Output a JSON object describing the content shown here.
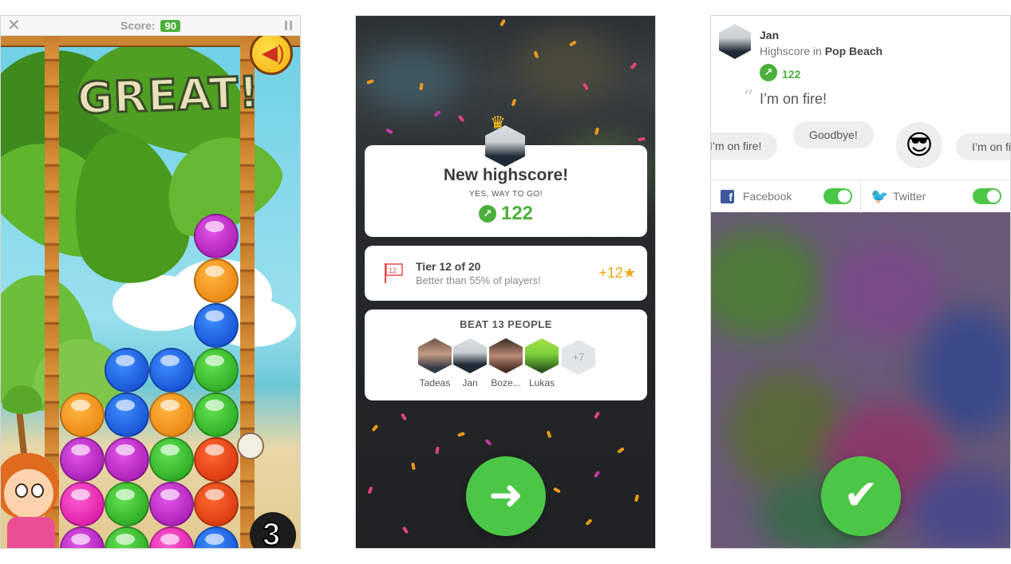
{
  "game": {
    "close_icon": "close-icon",
    "score_label": "Score:",
    "score_value": "90",
    "pause_icon": "pause-icon",
    "banner": "GREAT!",
    "sound_icon": "speaker-icon",
    "bomb_count": "3",
    "ball_colors": {
      "purple": "#c22ccc",
      "orange": "#f59a12",
      "blue": "#1563ef",
      "green": "#34c22a",
      "red": "#ea4a12",
      "pink": "#f033bb"
    }
  },
  "highscore": {
    "title": "New highscore!",
    "subtitle": "YES, WAY TO GO!",
    "score": "122",
    "tier": {
      "title": "Tier 12 of 20",
      "subtitle": "Better than 55% of players!",
      "flag_number": "12",
      "reward": "+12"
    },
    "beat": {
      "title": "BEAT 13 PEOPLE",
      "people": [
        {
          "name": "Tadeas"
        },
        {
          "name": "Jan"
        },
        {
          "name": "Boze..."
        },
        {
          "name": "Lukas"
        }
      ],
      "more": "+7"
    },
    "next_icon": "arrow-right-icon"
  },
  "share": {
    "user_name": "Jan",
    "highscore_prefix": "Highscore in",
    "game_name": "Pop Beach",
    "score": "122",
    "quote": "I’m on fire!",
    "chips": {
      "left": "I’m on fire!",
      "goodbye": "Goodbye!",
      "emoji": "😎",
      "right": "I’m on fire!"
    },
    "facebook_label": "Facebook",
    "twitter_label": "Twitter",
    "confirm_icon": "checkmark-icon"
  },
  "colors": {
    "accent_green": "#4caf3c",
    "button_green": "#4cc646",
    "reward_orange": "#f5a417",
    "facebook_blue": "#3b5998",
    "twitter_blue": "#1da1f2"
  }
}
